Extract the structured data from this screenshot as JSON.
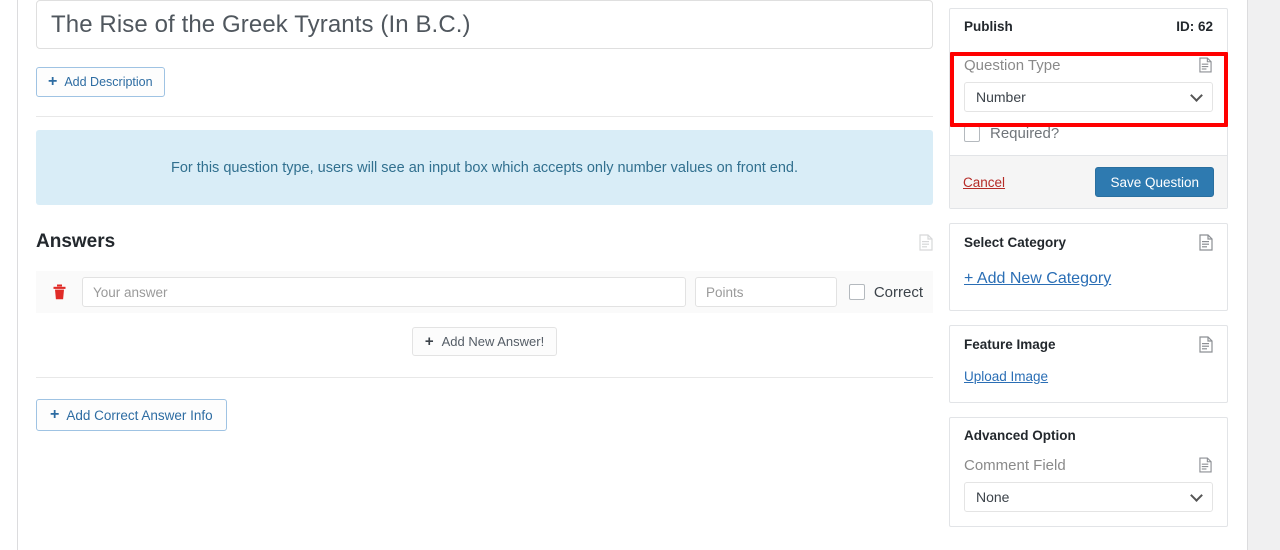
{
  "main": {
    "title_value": "The Rise of the Greek Tyrants (In B.C.)",
    "add_description_label": "Add Description",
    "plus": "+",
    "notice_text": "For this question type, users will see an input box which accepts only number values on front end.",
    "answers_heading": "Answers",
    "answer_row": {
      "answer_placeholder": "Your answer",
      "points_placeholder": "Points",
      "correct_label": "Correct"
    },
    "add_new_answer_label": "Add New Answer!",
    "add_correct_answer_info_label": "Add Correct Answer Info"
  },
  "sidebar": {
    "publish": {
      "title": "Publish",
      "id_label": "ID: 62",
      "question_type_label": "Question Type",
      "question_type_value": "Number",
      "required_label": "Required?",
      "cancel_label": "Cancel",
      "save_label": "Save Question"
    },
    "category": {
      "title": "Select Category",
      "add_new_category_label": "+ Add New Category"
    },
    "feature_image": {
      "title": "Feature Image",
      "upload_label": "Upload Image"
    },
    "advanced": {
      "title": "Advanced Option",
      "comment_field_label": "Comment Field",
      "comment_field_value": "None"
    }
  },
  "colors": {
    "highlight": "#ff0000",
    "notice_bg": "#d9edf7",
    "notice_text": "#31708f",
    "primary_button": "#2e7ab0",
    "danger": "#b52b27",
    "link": "#2a6eb5"
  }
}
